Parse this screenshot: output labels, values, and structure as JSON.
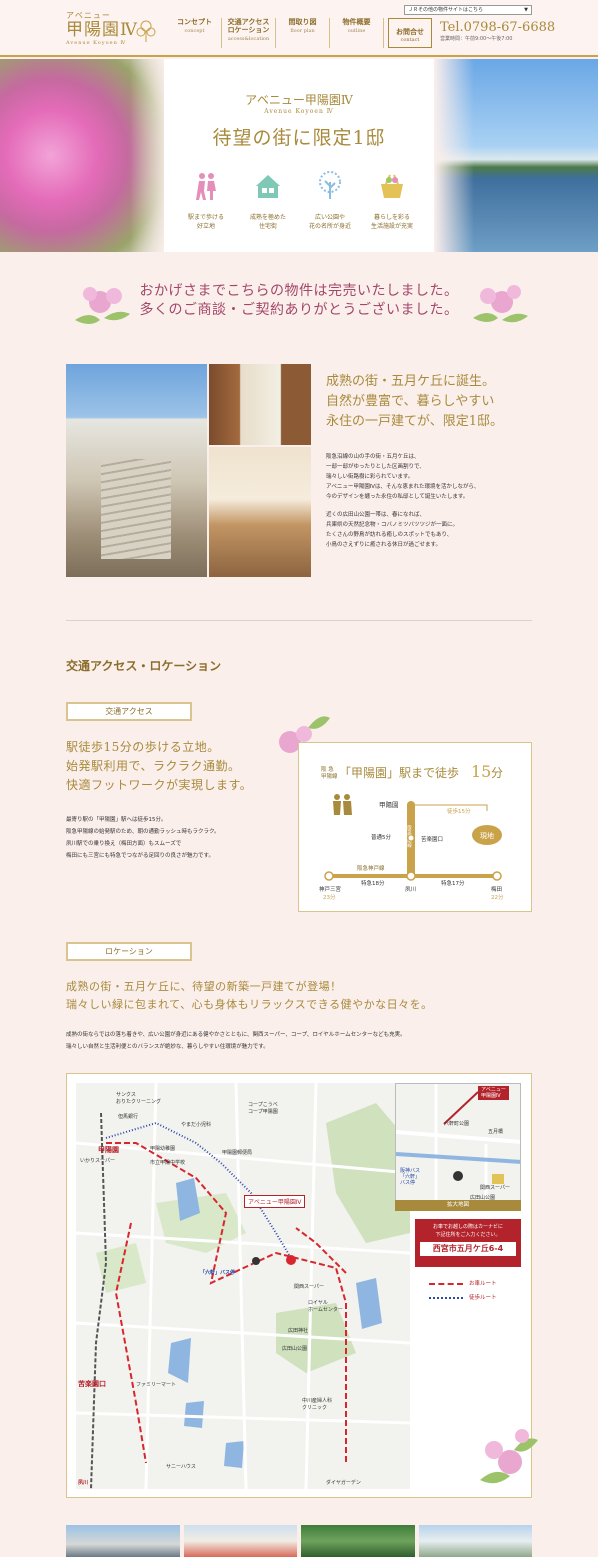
{
  "header": {
    "logo_sub": "アベニュー",
    "logo_main": "甲陽園Ⅳ",
    "logo_en": "Avenue Koyoen Ⅳ",
    "site_select": "ＪＲその他の物件サイトはこちら",
    "nav": [
      {
        "jp": "コンセプト",
        "en": "concept"
      },
      {
        "jp": "交通アクセス\nロケーション",
        "en": "access&location"
      },
      {
        "jp": "間取り図",
        "en": "floor plan"
      },
      {
        "jp": "物件概要",
        "en": "outline"
      }
    ],
    "contact_jp": "お問合せ",
    "contact_en": "contact",
    "tel": "Tel.0798-67-6688",
    "hours": "営業時間：午前9:00〜午後7:00"
  },
  "hero": {
    "name": "アベニュー甲陽園Ⅳ",
    "name_en": "Avenue Koyoen Ⅳ",
    "title": "待望の街に限定1邸",
    "features": [
      {
        "icon": "walking-people-icon",
        "label1": "駅まで歩ける",
        "label2": "好立地",
        "color": "#e48fb9"
      },
      {
        "icon": "house-icon",
        "label1": "成熟を極めた",
        "label2": "住宅街",
        "color": "#7fc8b6"
      },
      {
        "icon": "tree-icon",
        "label1": "広い公園や",
        "label2": "花の名所が身近",
        "color": "#8bbde0"
      },
      {
        "icon": "shopping-basket-icon",
        "label1": "暮らしを彩る",
        "label2": "生活施設が充実",
        "color": "#e3c257"
      }
    ]
  },
  "soldout": {
    "line1": "おかげさまでこちらの物件は完売いたしました。",
    "line2": "多くのご商談・ご契約ありがとうございました。"
  },
  "intro": {
    "head1": "成熟の街・五月ケ丘に誕生。",
    "head2": "自然が豊富で、暮らしやすい",
    "head3": "永住の一戸建てが、限定1邸。",
    "p1": [
      "阪急沿線の山の手の街・五月ケ丘は、",
      "一邸一邸がゆったりとした区画割りで、",
      "瑞々しい街路樹に彩られています。",
      "アベニュー甲陽園Ⅳは、そんな恵まれた環境を活かしながら、",
      "今のデザインを纏った永住の私邸として誕生いたします。"
    ],
    "p2": [
      "近くの広田山公園一帯は、春になれば、",
      "兵庫県の天然記念物・コバノミツバツツジが一面に。",
      "たくさんの野鳥が訪れる癒しのスポットでもあり、",
      "小鳥のさえずりに癒される休日が過ごせます。"
    ]
  },
  "access": {
    "section_title": "交通アクセス・ロケーション",
    "label": "交通アクセス",
    "head1": "駅徒歩15分の歩ける立地。",
    "head2": "始発駅利用で、ラクラク通勤。",
    "head3": "快適フットワークが実現します。",
    "body": [
      "最寄り駅の「甲陽園」駅へは徒歩15分。",
      "阪急甲陽線の始発駅のため、朝の通勤ラッシュ時もラクラク。",
      "夙川駅での乗り換え（梅田方面）もスムーズで",
      "梅田にも三宮にも特急でつながる足回りの良さが魅力です。"
    ],
    "route": {
      "line_label": "阪 急\n甲陽線",
      "title_pre": "「甲陽園」駅まで徒歩",
      "title_num": "15",
      "title_unit": "分",
      "station_koyoen": "甲陽園",
      "walk": "徒歩15分",
      "site": "現地",
      "line_vertical": "阪急甲陽線",
      "futsu": "普通5分",
      "kurakuen": "苦楽園口",
      "kobe_line": "阪急神戸線",
      "tokkyu18": "特急18分",
      "tokkyu17": "特急17分",
      "kobe": "神戸三宮",
      "kobe_min": "23分",
      "shukugawa": "夙川",
      "umeda": "梅田",
      "umeda_min": "22分"
    }
  },
  "location": {
    "label": "ロケーション",
    "head1": "成熟の街・五月ケ丘に、待望の新築一戸建てが登場！",
    "head2": "瑞々しい緑に包まれて、心も身体もリラックスできる健やかな日々を。",
    "body1": "成熟の街ならではの落ち着きや、広い公園が身近にある健やかさとともに、関西スーパー、コープ、ロイヤルホームセンターなども充実。",
    "body2": "瑞々しい自然と生活利便とのバランスが絶妙な、暮らしやすい住環境が魅力です。",
    "map_labels": {
      "sankus": "サンクス\nおりたクリーニング",
      "ikeda": "但馬銀行",
      "yamada": "やまだ小児科",
      "coop": "コープこうべ\nコープ甲陽園",
      "koyoen_st": "甲陽園",
      "ikari": "いかりスーパー",
      "kindergarten": "甲陽幼稚園",
      "junior": "市立甲陽中学校",
      "site_tag": "アベニュー甲陽園Ⅳ",
      "rokken_bus": "「六軒」バス停",
      "kansai": "関西スーパー",
      "royal": "ロイヤル\nホームセンター",
      "hirota_shrine": "広田神社",
      "hirota_park": "広田山公園",
      "kurakuen_st": "苦楽園口",
      "family": "ファミリーマート",
      "nakagawa": "中川産婦人科\nクリニック",
      "shukugawa_st": "夙川",
      "daiyagarden": "ダイヤガーデン",
      "post": "甲陽園郵便局",
      "sunny": "サニーハウス"
    },
    "inset_tag": "アベニュー\n甲陽園Ⅳ",
    "inset_labels": {
      "park": "六軒町公園",
      "gokenbashi": "五月橋",
      "bus": "阪神バス\n「六軒」\nバス停",
      "kansai": "関西スーパー",
      "hirota": "広田山公園"
    },
    "inset_caption": "拡大地図",
    "address_note1": "お車でお越しの際はカーナビに",
    "address_note2": "下記住所をご入力ください。",
    "address": "西宮市五月ケ丘6-4",
    "legend_car": "お車ルート",
    "legend_walk": "徒歩ルート"
  },
  "colors": {
    "gold": "#a88a3c",
    "pink": "#a3476a",
    "red": "#b3232b",
    "blue": "#2a4aa8",
    "bg": "#fbefec"
  }
}
